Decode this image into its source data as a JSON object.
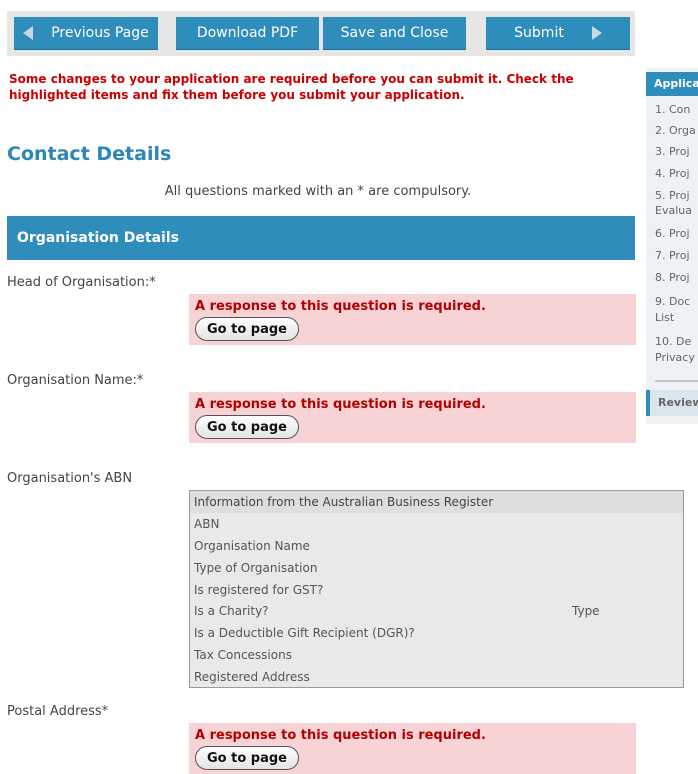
{
  "toolbar": {
    "previous": "Previous Page",
    "download": "Download PDF",
    "save_close": "Save and Close",
    "submit": "Submit"
  },
  "error_banner": "Some changes to your application are required before you can submit it. Check the highlighted items and fix them before you submit your application.",
  "section_title": "Contact Details",
  "compulsory_note": "All questions marked with an * are compulsory.",
  "org_header": "Organisation Details",
  "questions": {
    "head": "Head of Organisation:*",
    "org_name": "Organisation Name:*",
    "abn": "Organisation's ABN",
    "postal": "Postal Address*"
  },
  "error_required": "A response to this question is required.",
  "goto_label": "Go to page",
  "abn_table": {
    "title": "Information from the Australian Business Register",
    "rows": [
      "ABN",
      "Organisation Name",
      "Type of Organisation",
      "Is registered for GST?",
      "Is a Charity?",
      "Is a Deductible Gift Recipient (DGR)?",
      "Tax Concessions",
      "Registered Address"
    ],
    "charity_type_label": "Type"
  },
  "sidebar": {
    "header": "Applica",
    "items": [
      "1. Con",
      "2. Orga",
      "3. Proj",
      "4. Proj",
      "5. Proj",
      "Evalua",
      "6. Proj",
      "7. Proj",
      "8. Proj",
      "9. Doc",
      "List",
      "10. De",
      "Privacy"
    ],
    "review": "Review"
  }
}
